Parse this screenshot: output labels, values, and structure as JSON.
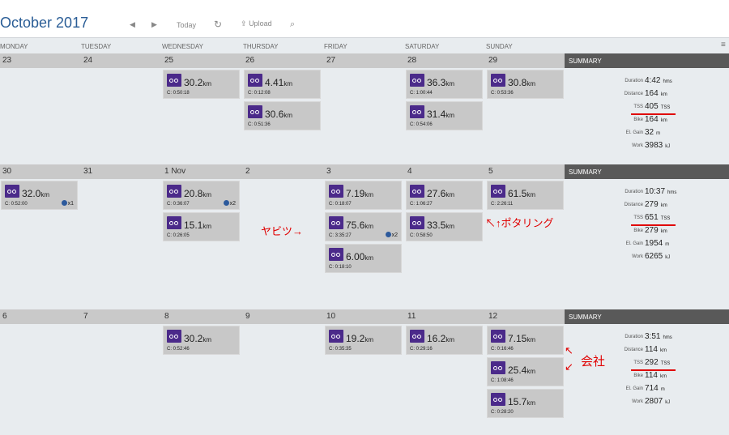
{
  "toolbar": {
    "month": "October",
    "year": "2017",
    "today": "Today",
    "upload": "Upload"
  },
  "days": [
    "MONDAY",
    "TUESDAY",
    "WEDNESDAY",
    "THURSDAY",
    "FRIDAY",
    "SATURDAY",
    "SUNDAY"
  ],
  "weeks": [
    {
      "dates": [
        "23",
        "24",
        "25",
        "26",
        "27",
        "28",
        "29"
      ],
      "summary_label": "SUMMARY",
      "summary": {
        "duration": "4:42",
        "distance": "164",
        "tss": "405",
        "bike": "164",
        "elgain": "32",
        "work": "3983"
      },
      "cards": [
        {
          "km": "30.2",
          "dur": "C: 0:50:18"
        },
        {
          "km": "4.41",
          "dur": "C: 0:12:08"
        },
        {
          "km": "30.6",
          "dur": "C: 0:51:36"
        },
        {
          "km": "36.3",
          "dur": "C: 1:00:44"
        },
        {
          "km": "31.4",
          "dur": "C: 0:54:06"
        },
        {
          "km": "30.8",
          "dur": "C: 0:53:36"
        }
      ]
    },
    {
      "dates": [
        "30",
        "31",
        "1 Nov",
        "2",
        "3",
        "4",
        "5"
      ],
      "summary_label": "SUMMARY",
      "summary": {
        "duration": "10:37",
        "distance": "279",
        "tss": "651",
        "bike": "279",
        "elgain": "1954",
        "work": "6265"
      },
      "cards": [
        {
          "km": "32.0",
          "dur": "C: 0:52:00",
          "medal": "x1"
        },
        {
          "km": "20.8",
          "dur": "C: 0:36:07",
          "medal": "x2"
        },
        {
          "km": "15.1",
          "dur": "C: 0:26:05"
        },
        {
          "km": "7.19",
          "dur": "C: 0:18:07"
        },
        {
          "km": "75.6",
          "dur": "C: 3:35:27",
          "medal": "x2"
        },
        {
          "km": "6.00",
          "dur": "C: 0:18:10"
        },
        {
          "km": "27.6",
          "dur": "C: 1:06:27"
        },
        {
          "km": "33.5",
          "dur": "C: 0:58:50"
        },
        {
          "km": "61.5",
          "dur": "C: 2:26:11"
        }
      ]
    },
    {
      "dates": [
        "6",
        "7",
        "8",
        "9",
        "10",
        "11",
        "12"
      ],
      "summary_label": "SUMMARY",
      "summary": {
        "duration": "3:51",
        "distance": "114",
        "tss": "292",
        "bike": "114",
        "elgain": "714",
        "work": "2807"
      },
      "cards": [
        {
          "km": "30.2",
          "dur": "C: 0:52:46"
        },
        {
          "km": "19.2",
          "dur": "C: 0:35:35"
        },
        {
          "km": "16.2",
          "dur": "C: 0:29:16"
        },
        {
          "km": "7.15",
          "dur": "C: 0:16:46"
        },
        {
          "km": "25.4",
          "dur": "C: 1:08:46"
        },
        {
          "km": "15.7",
          "dur": "C: 0:28:20"
        }
      ]
    }
  ],
  "labels": {
    "duration": "Duration",
    "distance": "Distance",
    "tss": "TSS",
    "bike": "Bike",
    "elgain": "El. Gain",
    "work": "Work",
    "hms": "hms",
    "km": "km",
    "tss_unit": "TSS",
    "m": "m",
    "kj": "kJ"
  },
  "annotations": {
    "yabitsu": "ヤビツ→",
    "potaring": "↖↑ポタリング",
    "kaisha": "会社",
    "arrow_up": "↖",
    "arrow_down": "↙"
  },
  "colors": {
    "brand": "#2a5d96",
    "icon": "#4b2a8a",
    "annotation": "#e00000"
  }
}
